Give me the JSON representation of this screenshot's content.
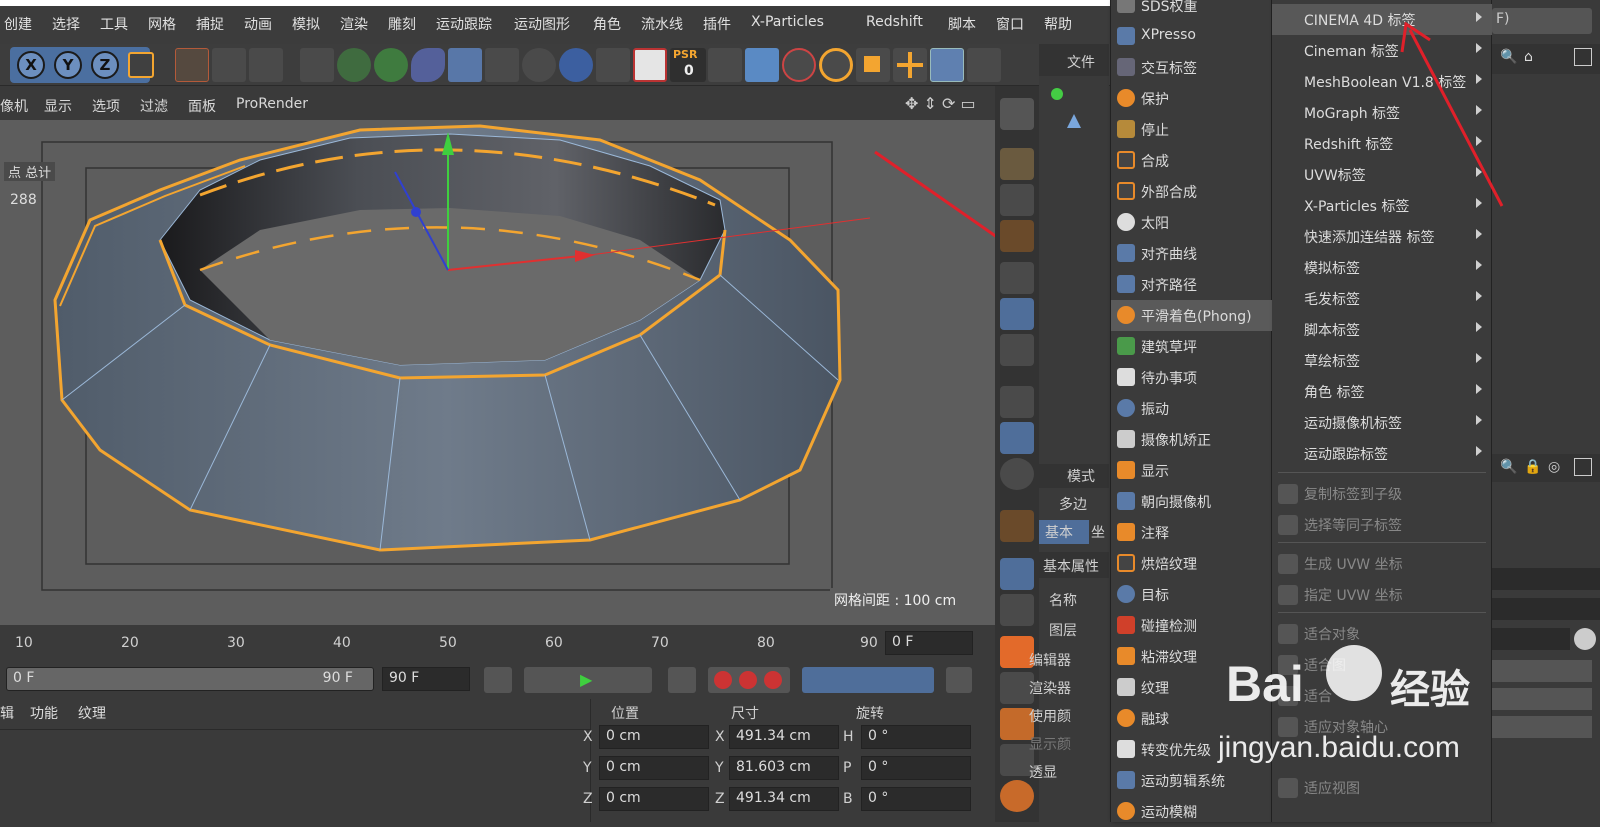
{
  "menubar": {
    "items": [
      "创建",
      "选择",
      "工具",
      "网格",
      "捕捉",
      "动画",
      "模拟",
      "渲染",
      "雕刻",
      "运动跟踪",
      "运动图形",
      "角色",
      "流水线",
      "插件",
      "X-Particles",
      "Redshift",
      "脚本",
      "窗口",
      "帮助"
    ]
  },
  "toolbar": {
    "x_label": "X",
    "y_label": "Y",
    "z_label": "Z",
    "psr_label": "PSR",
    "psr_value": "0"
  },
  "viewport_menu": {
    "items": [
      "像机",
      "显示",
      "选项",
      "过滤",
      "面板",
      "ProRender"
    ]
  },
  "viewport": {
    "stats_label": "总计",
    "stats_prefix": "点",
    "stats_value": "288",
    "grid_spacing": "网格间距 : 100 cm"
  },
  "timeline": {
    "ticks": [
      "10",
      "20",
      "30",
      "40",
      "50",
      "60",
      "70",
      "80",
      "90"
    ],
    "current_frame": "0 F"
  },
  "playbar": {
    "range_start": "0 F",
    "range_end": "90 F",
    "end_frame": "90 F"
  },
  "material_panel": {
    "tabs": [
      "辑",
      "功能",
      "纹理"
    ]
  },
  "coordinates": {
    "headers": [
      "位置",
      "尺寸",
      "旋转"
    ],
    "rows": [
      {
        "axis": "X",
        "pos": "0 cm",
        "size_axis": "X",
        "size": "491.34 cm",
        "rot_axis": "H",
        "rot": "0 °"
      },
      {
        "axis": "Y",
        "pos": "0 cm",
        "size_axis": "Y",
        "size": "81.603 cm",
        "rot_axis": "P",
        "rot": "0 °"
      },
      {
        "axis": "Z",
        "pos": "0 cm",
        "size_axis": "Z",
        "size": "491.34 cm",
        "rot_axis": "B",
        "rot": "0 °"
      }
    ]
  },
  "object_panel": {
    "file_label": "文件"
  },
  "attribute_panel": {
    "mode_label": "模式",
    "object_label": "多边",
    "tab_basic": "基本",
    "tab_coord": "坐",
    "section": "基本属性",
    "fields": [
      "名称",
      "图层",
      "编辑器",
      "渲染器",
      "使用颜",
      "显示颜",
      "透显"
    ]
  },
  "tags_menu": {
    "items": [
      {
        "label": "SDS权重",
        "icon": "sds-weight-icon"
      },
      {
        "label": "XPresso",
        "icon": "xpresso-icon"
      },
      {
        "label": "交互标签",
        "icon": "interaction-tag-icon"
      },
      {
        "label": "保护",
        "icon": "protection-icon"
      },
      {
        "label": "停止",
        "icon": "stop-icon"
      },
      {
        "label": "合成",
        "icon": "compositing-icon"
      },
      {
        "label": "外部合成",
        "icon": "external-compositing-icon"
      },
      {
        "label": "太阳",
        "icon": "sun-icon"
      },
      {
        "label": "对齐曲线",
        "icon": "align-spline-icon"
      },
      {
        "label": "对齐路径",
        "icon": "align-path-icon"
      },
      {
        "label": "平滑着色(Phong)",
        "icon": "phong-icon",
        "highlighted": true
      },
      {
        "label": "建筑草坪",
        "icon": "grass-icon"
      },
      {
        "label": "待办事项",
        "icon": "todo-icon"
      },
      {
        "label": "振动",
        "icon": "vibrate-icon"
      },
      {
        "label": "摄像机矫正",
        "icon": "camera-calibrator-icon"
      },
      {
        "label": "显示",
        "icon": "display-icon"
      },
      {
        "label": "朝向摄像机",
        "icon": "look-at-camera-icon"
      },
      {
        "label": "注释",
        "icon": "annotation-icon"
      },
      {
        "label": "烘焙纹理",
        "icon": "bake-texture-icon"
      },
      {
        "label": "目标",
        "icon": "target-icon"
      },
      {
        "label": "碰撞检测",
        "icon": "collision-icon"
      },
      {
        "label": "粘滞纹理",
        "icon": "stick-texture-icon"
      },
      {
        "label": "纹理",
        "icon": "texture-icon"
      },
      {
        "label": "融球",
        "icon": "metaball-icon"
      },
      {
        "label": "转变优先级",
        "icon": "priority-icon"
      },
      {
        "label": "运动剪辑系统",
        "icon": "motion-clip-icon"
      },
      {
        "label": "运动模糊",
        "icon": "motion-blur-icon"
      }
    ]
  },
  "tags_submenu": {
    "items": [
      {
        "label": "CINEMA 4D 标签",
        "submenu": true,
        "highlighted": true
      },
      {
        "label": "Cineman 标签",
        "submenu": true
      },
      {
        "label": "MeshBoolean V1.8 标签",
        "submenu": true
      },
      {
        "label": "MoGraph 标签",
        "submenu": true
      },
      {
        "label": "Redshift 标签",
        "submenu": true
      },
      {
        "label": "UVW标签",
        "submenu": true
      },
      {
        "label": "X-Particles 标签",
        "submenu": true
      },
      {
        "label": "快速添加连结器 标签",
        "submenu": true
      },
      {
        "label": "模拟标签",
        "submenu": true
      },
      {
        "label": "毛发标签",
        "submenu": true
      },
      {
        "label": "脚本标签",
        "submenu": true
      },
      {
        "label": "草绘标签",
        "submenu": true
      },
      {
        "label": "角色 标签",
        "submenu": true
      },
      {
        "label": "运动摄像机标签",
        "submenu": true
      },
      {
        "label": "运动跟踪标签",
        "submenu": true
      }
    ],
    "disabled_items": [
      "复制标签到子级",
      "选择等同子标签",
      "生成 UVW 坐标",
      "指定 UVW 坐标",
      "适合对象",
      "适合图",
      "适合",
      "适应对象轴心",
      "适应视图"
    ]
  },
  "far_right": {
    "hint": "F)"
  },
  "watermark": {
    "logo": "Bai",
    "logo_cn": "经验",
    "url": "jingyan.baidu.com"
  },
  "colors": {
    "accent_orange": "#f3a530",
    "arrow_red": "#e0202a",
    "panel_bg": "#3a3a3a",
    "viewport_bg": "#5d5d5d",
    "highlight": "#5a5a5a"
  }
}
